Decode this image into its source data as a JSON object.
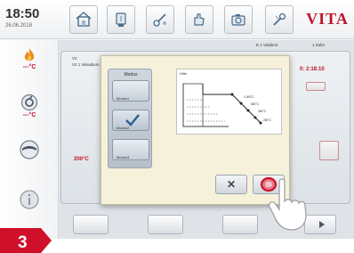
{
  "status": {
    "time": "18:50",
    "date": "26.06.2018"
  },
  "brand": "VITA",
  "topbar": {
    "icons": [
      "home-icon",
      "furnace-icon",
      "tools-icon",
      "hand-icon",
      "camera-icon",
      "settings-icon"
    ]
  },
  "sidebar": {
    "items": [
      {
        "icon": "flame-icon",
        "temp": "---°C"
      },
      {
        "icon": "pump-icon",
        "temp": "---°C"
      },
      {
        "icon": "cooling-icon",
        "temp": ""
      },
      {
        "icon": "info-icon",
        "temp": ""
      }
    ]
  },
  "program": {
    "id": "V2",
    "name": "V2 1 Vanadium",
    "header_right1": "E 1 Vladimir",
    "header_right2": "1 Zahn",
    "time": "0: 2:18:10",
    "temp": "200°C"
  },
  "dialog": {
    "mode_title": "Modus",
    "modes": [
      {
        "label": "Modus1",
        "selected": false
      },
      {
        "label": "Modus2",
        "selected": true
      },
      {
        "label": "Modus3",
        "selected": false
      }
    ],
    "info_title": "Hilfe",
    "chart_labels": [
      "1 000°C",
      "500°C",
      "300°C",
      "200°C"
    ],
    "colors": {
      "accent": "#c0122a",
      "modal_bg": "#f6f1da",
      "confirm": "#d0102a"
    }
  },
  "step_badge": "3"
}
